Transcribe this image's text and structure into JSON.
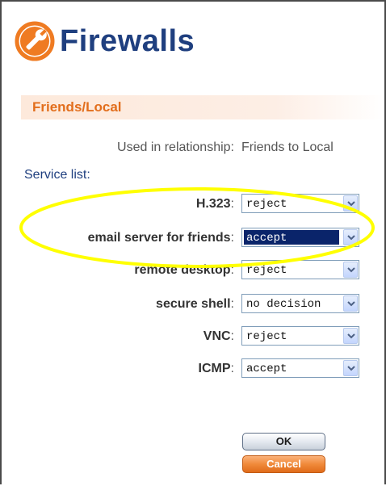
{
  "header": {
    "title": "Firewalls",
    "icon": "wrench-icon"
  },
  "section": {
    "title": "Friends/Local"
  },
  "relationship": {
    "label": "Used in relationship:",
    "value": "Friends to Local"
  },
  "service_list_label": "Service list:",
  "services": [
    {
      "name": "H.323",
      "value": "reject"
    },
    {
      "name": "email server for friends",
      "value": "accept",
      "selected": true
    },
    {
      "name": "remote desktop",
      "value": "reject"
    },
    {
      "name": "secure shell",
      "value": "no decision"
    },
    {
      "name": "VNC",
      "value": "reject"
    },
    {
      "name": "ICMP",
      "value": "accept"
    }
  ],
  "buttons": {
    "ok": "OK",
    "cancel": "Cancel"
  },
  "colors": {
    "title": "#1f3f7f",
    "section_title": "#e26e1c",
    "section_bar": "#fde9db",
    "highlight": "#ffff00",
    "cancel_button": "#f08a3a",
    "selected_option_bg": "#0a246a"
  }
}
